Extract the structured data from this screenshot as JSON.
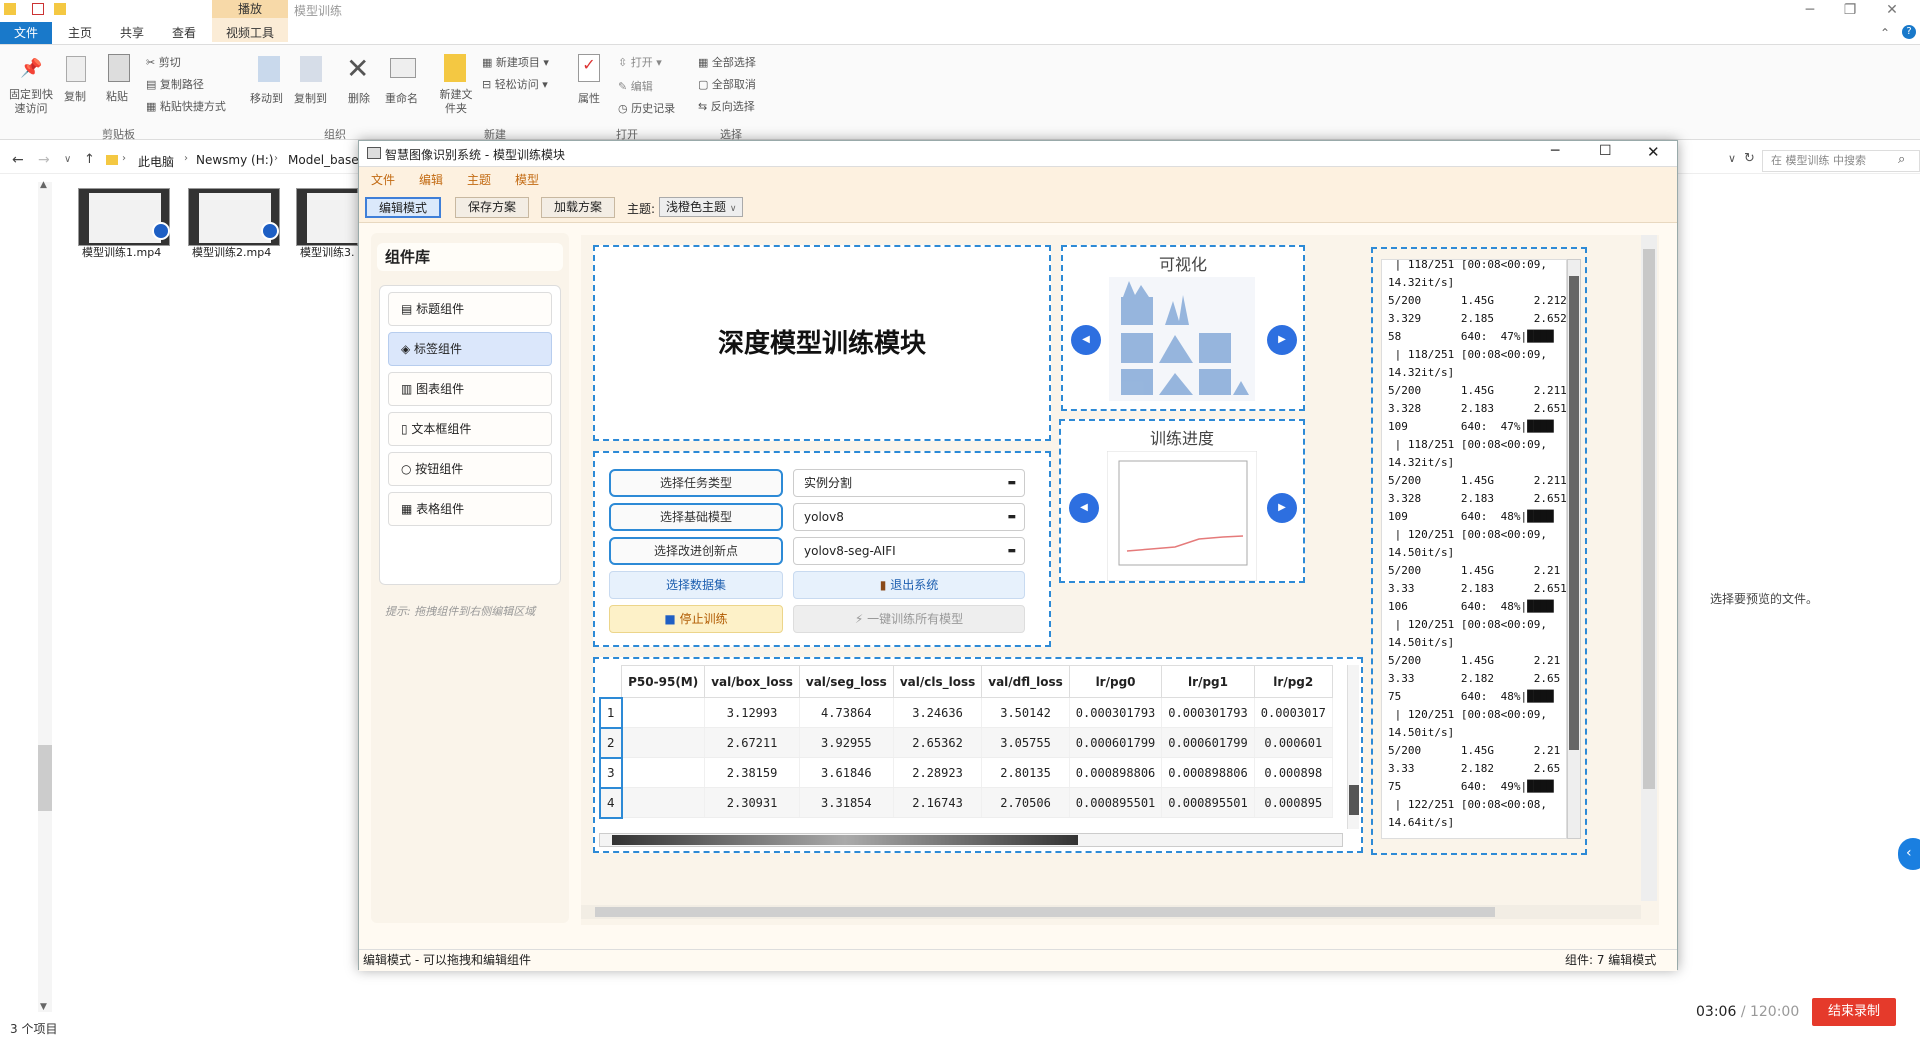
{
  "explorer": {
    "context_tab": "播放",
    "window_title": "模型训练",
    "tabs": [
      "文件",
      "主页",
      "共享",
      "查看"
    ],
    "video_tools": "视频工具",
    "ribbon": {
      "pin": "固定到快速访问",
      "copy": "复制",
      "paste": "粘贴",
      "cut": "剪切",
      "copy_path": "复制路径",
      "paste_shortcut": "粘贴快捷方式",
      "move_to": "移动到",
      "copy_to": "复制到",
      "delete": "删除",
      "rename": "重命名",
      "new_folder": "新建文件夹",
      "new_item": "新建项目",
      "easy_access": "轻松访问",
      "properties": "属性",
      "open": "打开",
      "edit": "编辑",
      "history": "历史记录",
      "select_all": "全部选择",
      "select_none": "全部取消",
      "invert": "反向选择",
      "groups": [
        "剪贴板",
        "组织",
        "新建",
        "打开",
        "选择"
      ]
    },
    "breadcrumb": [
      "此电脑",
      "Newsmy (H:)",
      "Model_base"
    ],
    "search_placeholder": "在 模型训练 中搜索",
    "files": [
      "模型训练1.mp4",
      "模型训练2.mp4",
      "模型训练3."
    ],
    "preview_text": "选择要预览的文件。",
    "item_count": "3 个项目",
    "timer_elapsed": "03:06",
    "timer_total": "/ 120:00",
    "record_button": "结束录制"
  },
  "app": {
    "title": "智慧图像识别系统 - 模型训练模块",
    "menu": [
      "文件",
      "编辑",
      "主题",
      "模型"
    ],
    "toolbar": {
      "edit_mode": "编辑模式",
      "save_plan": "保存方案",
      "load_plan": "加载方案",
      "theme_label": "主题:",
      "theme_value": "浅橙色主题"
    },
    "library": {
      "title": "组件库",
      "items": [
        "标题组件",
        "标签组件",
        "图表组件",
        "文本框组件",
        "按钮组件",
        "表格组件"
      ],
      "hint": "提示: 拖拽组件到右侧编辑区域"
    },
    "main_title": "深度模型训练模块",
    "controls": {
      "task_type_btn": "选择任务类型",
      "task_type_value": "实例分割",
      "base_model_btn": "选择基础模型",
      "base_model_value": "yolov8",
      "innovation_btn": "选择改进创新点",
      "innovation_value": "yolov8-seg-AIFI",
      "dataset_btn": "选择数据集",
      "exit_btn": "退出系统",
      "stop_btn": "停止训练",
      "train_all_btn": "一键训练所有模型"
    },
    "viz_title": "可视化",
    "progress_title": "训练进度",
    "table": {
      "columns": [
        "P50-95(M)",
        "val/box_loss",
        "val/seg_loss",
        "val/cls_loss",
        "val/dfl_loss",
        "lr/pg0",
        "lr/pg1",
        "lr/pg2"
      ],
      "rows": [
        [
          "1",
          "",
          "3.12993",
          "4.73864",
          "3.24636",
          "3.50142",
          "0.000301793",
          "0.000301793",
          "0.0003017"
        ],
        [
          "2",
          "",
          "2.67211",
          "3.92955",
          "2.65362",
          "3.05755",
          "0.000601799",
          "0.000601799",
          "0.000601"
        ],
        [
          "3",
          "",
          "2.38159",
          "3.61846",
          "2.28923",
          "2.80135",
          "0.000898806",
          "0.000898806",
          "0.000898"
        ],
        [
          "4",
          "",
          "2.30931",
          "3.31854",
          "2.16743",
          "2.70506",
          "0.000895501",
          "0.000895501",
          "0.000895"
        ]
      ]
    },
    "log": " | 118/251 [00:08<00:09,\n14.32it/s]\n5/200      1.45G      2.212\n3.329      2.185      2.652\n58         640:  47%|████\n | 118/251 [00:08<00:09,\n14.32it/s]\n5/200      1.45G      2.211\n3.328      2.183      2.651\n109        640:  47%|████\n | 118/251 [00:08<00:09,\n14.32it/s]\n5/200      1.45G      2.211\n3.328      2.183      2.651\n109        640:  48%|████\n | 120/251 [00:08<00:09,\n14.50it/s]\n5/200      1.45G      2.21\n3.33       2.183      2.651\n106        640:  48%|████\n | 120/251 [00:08<00:09,\n14.50it/s]\n5/200      1.45G      2.21\n3.33       2.182      2.65\n75         640:  48%|████\n | 120/251 [00:08<00:09,\n14.50it/s]\n5/200      1.45G      2.21\n3.33       2.182      2.65\n75         640:  49%|████\n | 122/251 [00:08<00:08,\n14.64it/s]",
    "status_left": "编辑模式 - 可以拖拽和编辑组件",
    "status_right": "组件: 7  编辑模式"
  }
}
